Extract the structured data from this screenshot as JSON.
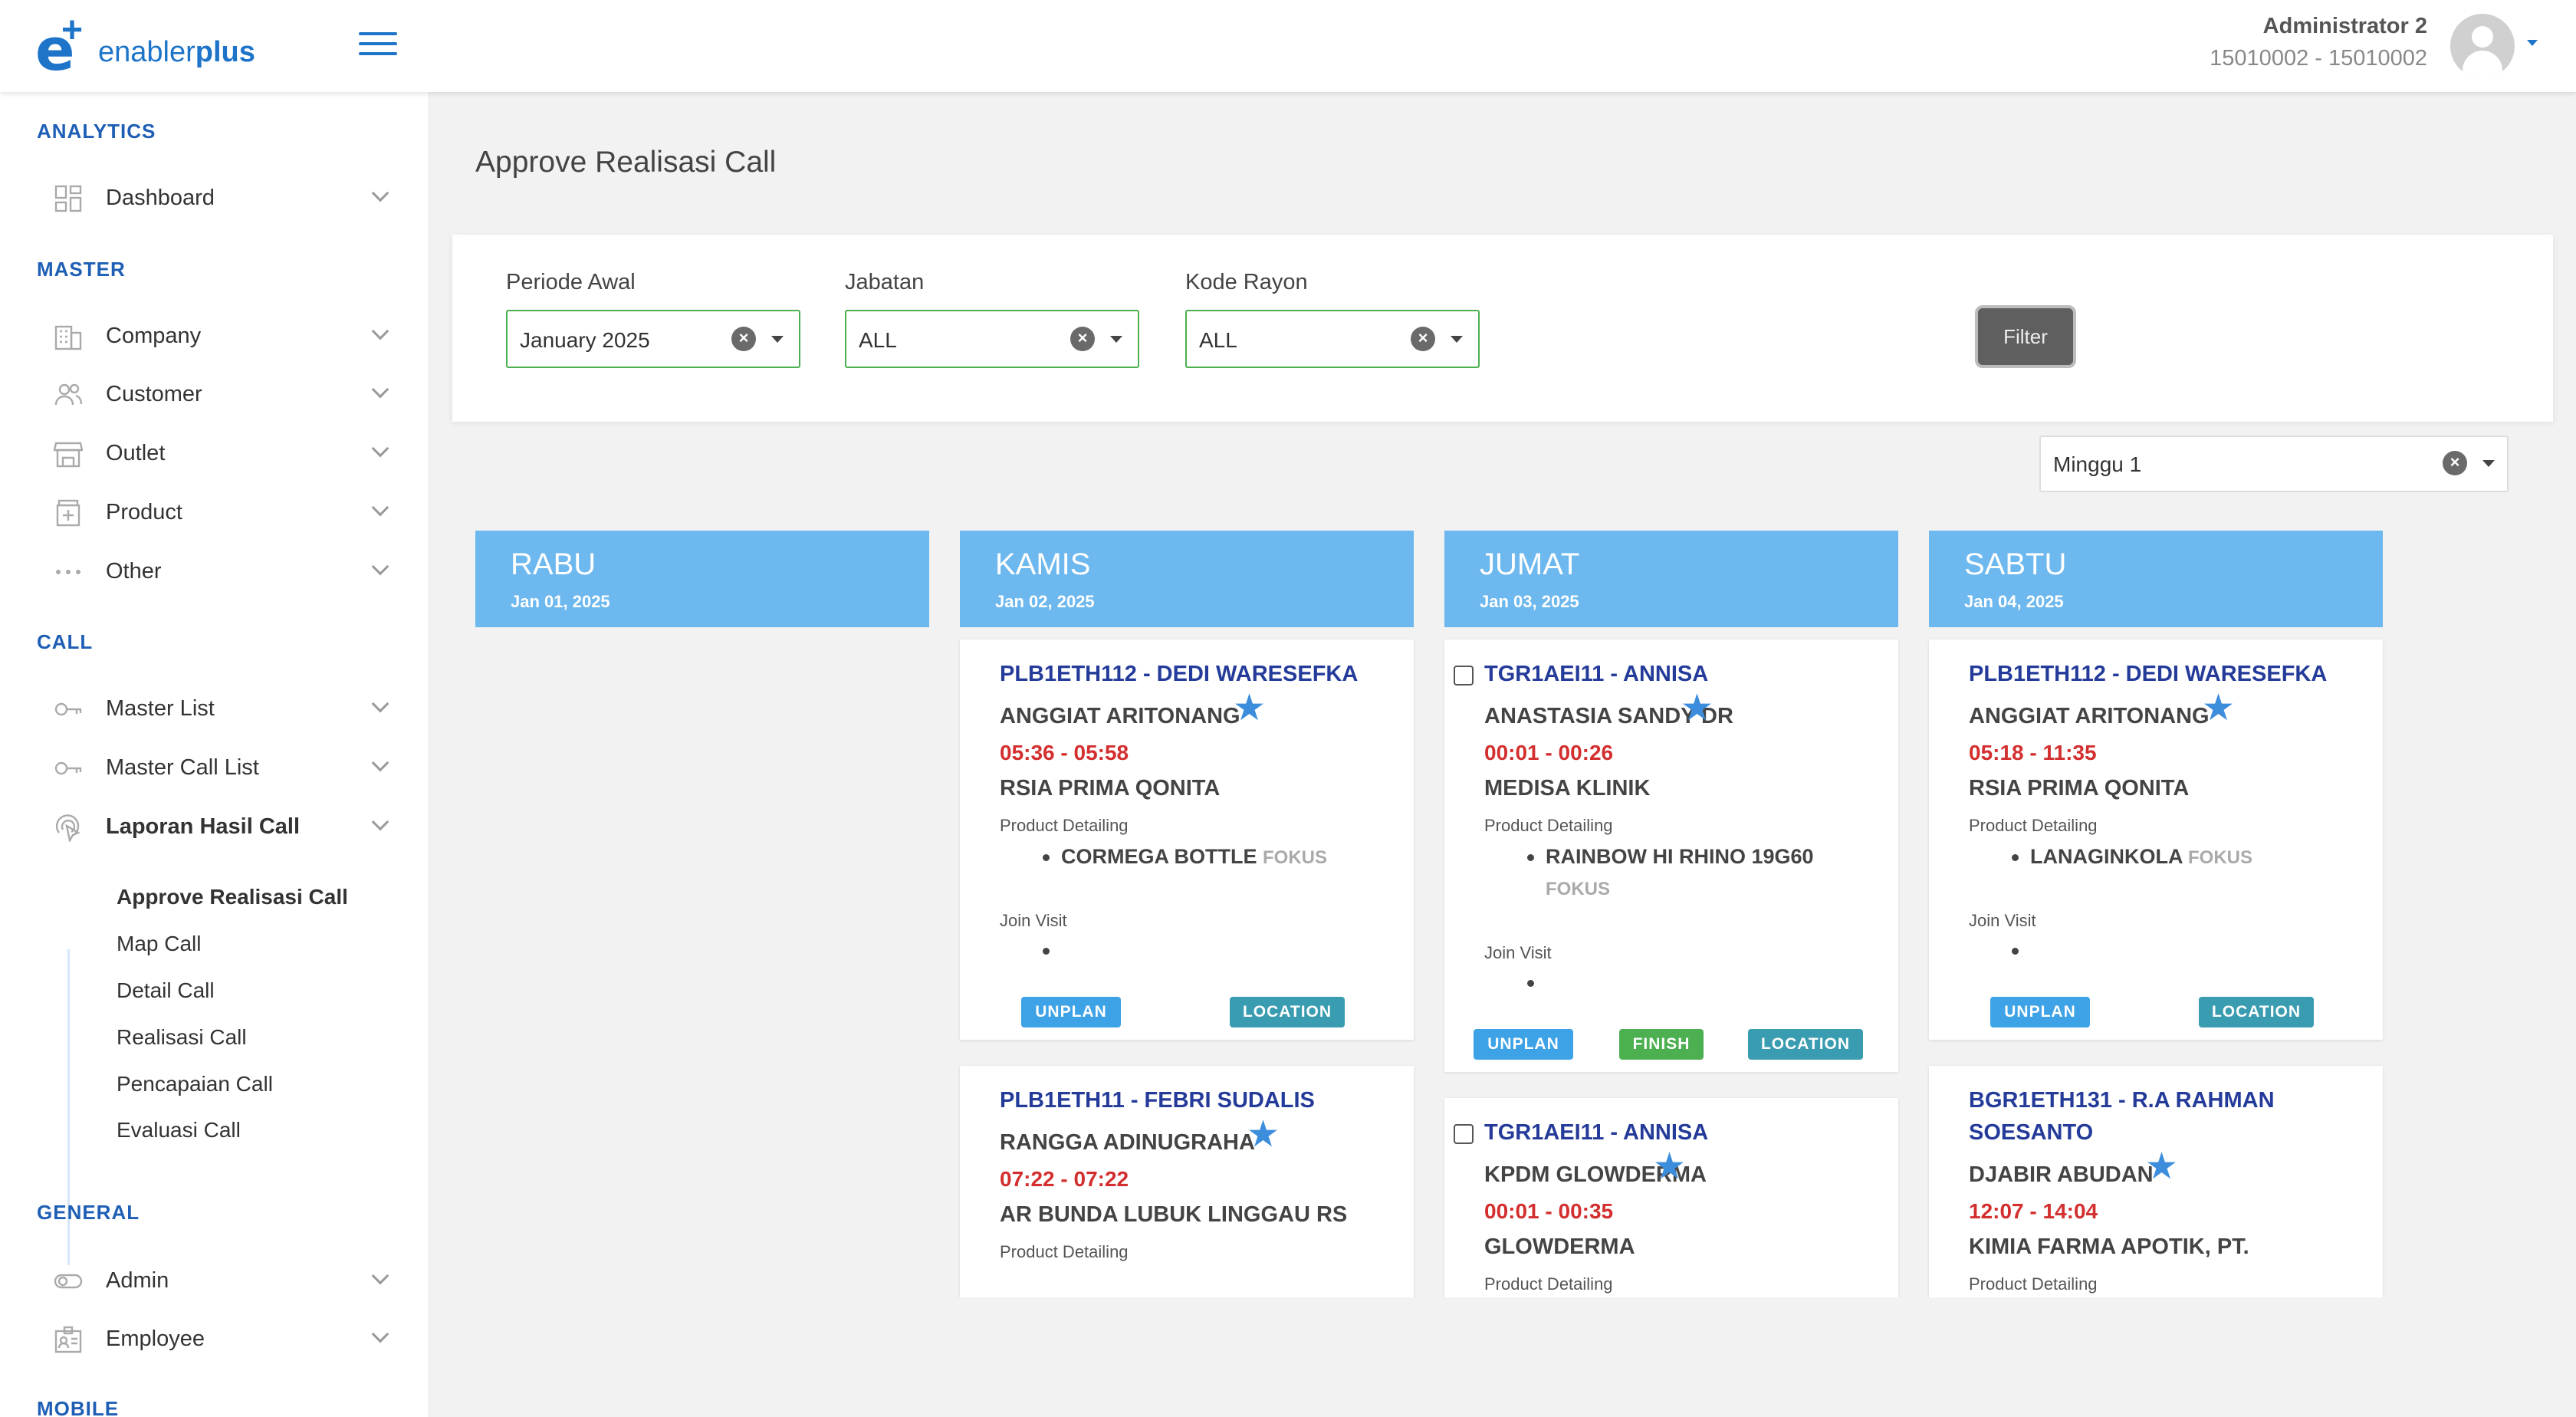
{
  "brand": {
    "logo_mark": "e",
    "logo_plus": "+",
    "name_light": "enabler",
    "name_bold": "plus"
  },
  "user": {
    "name": "Administrator 2",
    "id": "15010002 - 15010002"
  },
  "sidebar": {
    "sections": {
      "analytics": "ANALYTICS",
      "master": "MASTER",
      "call": "CALL",
      "general": "GENERAL",
      "mobile": "MOBILE"
    },
    "items": {
      "dashboard": "Dashboard",
      "company": "Company",
      "customer": "Customer",
      "outlet": "Outlet",
      "product": "Product",
      "other": "Other",
      "master_list": "Master List",
      "master_call_list": "Master Call List",
      "laporan_hasil_call": "Laporan Hasil Call",
      "admin": "Admin",
      "employee": "Employee"
    },
    "sub_items": [
      "Approve Realisasi Call",
      "Map Call",
      "Detail Call",
      "Realisasi Call",
      "Pencapaian Call",
      "Evaluasi Call"
    ]
  },
  "page": {
    "title": "Approve Realisasi Call"
  },
  "filters": {
    "periode_label": "Periode Awal",
    "periode_value": "January 2025",
    "jabatan_label": "Jabatan",
    "jabatan_value": "ALL",
    "rayon_label": "Kode Rayon",
    "rayon_value": "ALL",
    "filter_button": "Filter",
    "clear_glyph": "×"
  },
  "week": {
    "value": "Minggu 1"
  },
  "days": [
    {
      "day": "RABU",
      "date": "Jan 01, 2025"
    },
    {
      "day": "KAMIS",
      "date": "Jan 02, 2025"
    },
    {
      "day": "JUMAT",
      "date": "Jan 03, 2025"
    },
    {
      "day": "SABTU",
      "date": "Jan 04, 2025"
    }
  ],
  "labels": {
    "product_detailing": "Product Detailing",
    "join_visit": "Join Visit",
    "fokus": "FOKUS",
    "star": "★"
  },
  "badges": {
    "unplan": "UNPLAN",
    "location": "LOCATION",
    "finish": "FINISH"
  },
  "cards": {
    "kamis1": {
      "header": "PLB1ETH112 - DEDI WARESEFKA",
      "name": "ANGGIAT ARITONANG",
      "time": "05:36 - 05:58",
      "outlet": "RSIA PRIMA QONITA",
      "product": "CORMEGA BOTTLE"
    },
    "kamis2": {
      "header": "PLB1ETH11 - FEBRI SUDALIS",
      "name": "RANGGA ADINUGRAHA",
      "time": "07:22 - 07:22",
      "outlet": "AR BUNDA LUBUK LINGGAU RS"
    },
    "jumat1": {
      "header": "TGR1AEI11 - ANNISA",
      "name": "ANASTASIA SANDY DR",
      "time": "00:01 - 00:26",
      "outlet": "MEDISA KLINIK",
      "product": "RAINBOW HI RHINO 19G60"
    },
    "jumat2": {
      "header": "TGR1AEI11 - ANNISA",
      "name": "KPDM GLOWDERMA",
      "time": "00:01 - 00:35",
      "outlet": "GLOWDERMA"
    },
    "sabtu1": {
      "header": "PLB1ETH112 - DEDI WARESEFKA",
      "name": "ANGGIAT ARITONANG",
      "time": "05:18 - 11:35",
      "outlet": "RSIA PRIMA QONITA",
      "product": "LANAGINKOLA"
    },
    "sabtu2": {
      "header": "BGR1ETH131 - R.A RAHMAN SOESANTO",
      "name": "DJABIR ABUDAN",
      "time": "12:07 - 14:04",
      "outlet": "KIMIA FARMA APOTIK, PT."
    }
  }
}
